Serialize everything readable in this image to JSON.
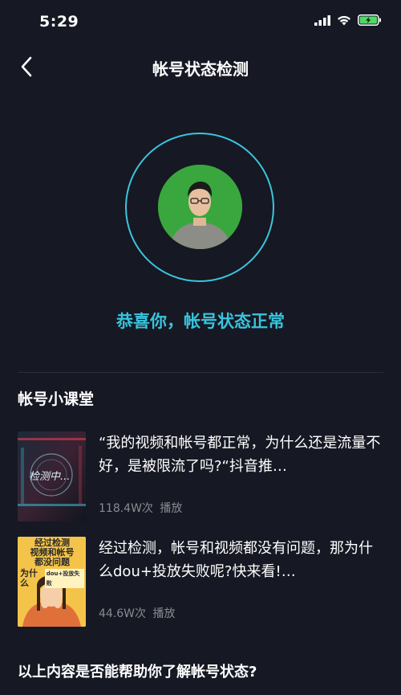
{
  "status_bar": {
    "time": "5:29"
  },
  "nav": {
    "title": "帐号状态检测"
  },
  "result": {
    "message": "恭喜你，帐号状态正常"
  },
  "section": {
    "title": "帐号小课堂"
  },
  "courses": [
    {
      "title": "“我的视频和帐号都正常，为什么还是流量不好，是被限流了吗?“抖音推…",
      "plays": "118.4W次",
      "play_label": "播放",
      "thumb_text": "检测中..."
    },
    {
      "title": "经过检测，帐号和视频都没有问题，那为什么dou+投放失败呢?快来看!…",
      "plays": "44.6W次",
      "play_label": "播放",
      "thumb_lines": [
        "经过检测",
        "视频和帐号",
        "都没问题",
        "为什么",
        "dou+投放失败"
      ]
    }
  ],
  "footer": {
    "question": "以上内容是否能帮助你了解帐号状态?"
  }
}
